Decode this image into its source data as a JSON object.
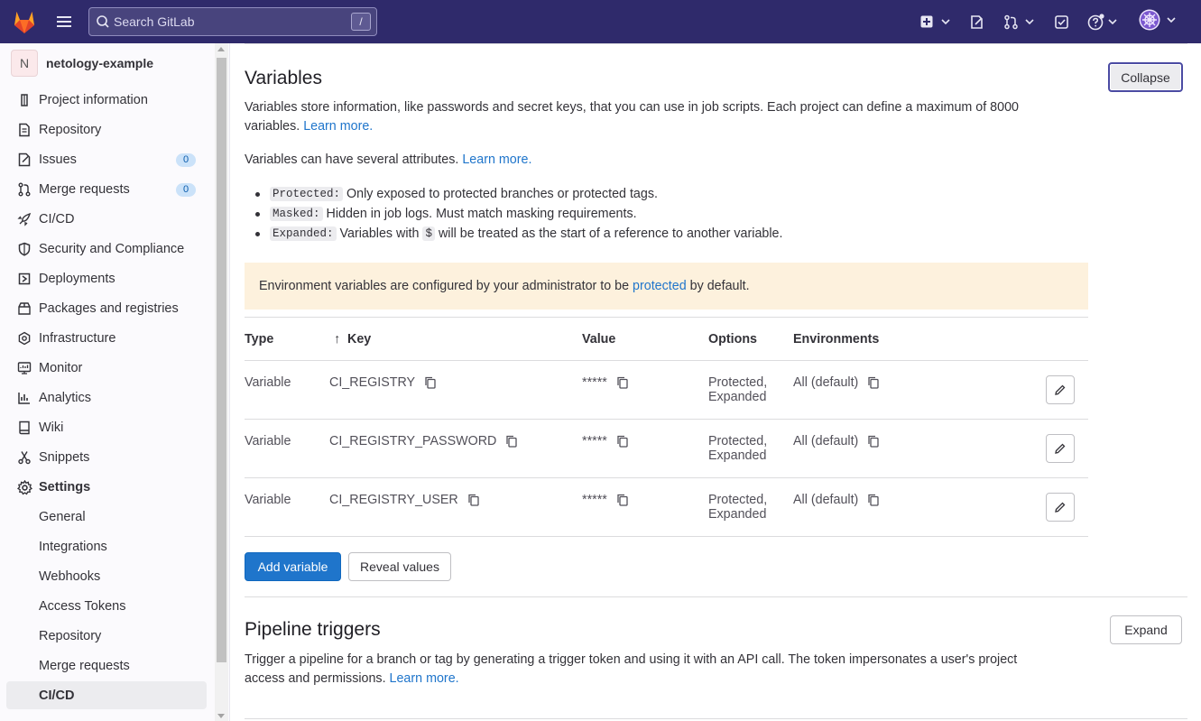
{
  "topbar": {
    "search_placeholder": "Search GitLab",
    "search_shortcut": "/"
  },
  "sidebar": {
    "project_initial": "N",
    "project_name": "netology-example",
    "items": [
      {
        "label": "Project information",
        "icon": "info-icon"
      },
      {
        "label": "Repository",
        "icon": "doc-icon"
      },
      {
        "label": "Issues",
        "icon": "issues-icon",
        "badge": "0"
      },
      {
        "label": "Merge requests",
        "icon": "merge-request-icon",
        "badge": "0"
      },
      {
        "label": "CI/CD",
        "icon": "rocket-icon"
      },
      {
        "label": "Security and Compliance",
        "icon": "shield-icon"
      },
      {
        "label": "Deployments",
        "icon": "deployments-icon"
      },
      {
        "label": "Packages and registries",
        "icon": "package-icon"
      },
      {
        "label": "Infrastructure",
        "icon": "cloud-gear-icon"
      },
      {
        "label": "Monitor",
        "icon": "monitor-icon"
      },
      {
        "label": "Analytics",
        "icon": "chart-icon"
      },
      {
        "label": "Wiki",
        "icon": "book-icon"
      },
      {
        "label": "Snippets",
        "icon": "scissors-icon"
      },
      {
        "label": "Settings",
        "icon": "gear-icon"
      }
    ],
    "settings_sub": [
      "General",
      "Integrations",
      "Webhooks",
      "Access Tokens",
      "Repository",
      "Merge requests",
      "CI/CD"
    ]
  },
  "variables": {
    "title": "Variables",
    "collapse_label": "Collapse",
    "intro": "Variables store information, like passwords and secret keys, that you can use in job scripts. Each project can define a maximum of 8000",
    "intro_line2": "variables.",
    "learn_more": "Learn more.",
    "attrs_text": "Variables can have several attributes.",
    "bullets": [
      {
        "code": "Protected:",
        "text": "Only exposed to protected branches or protected tags."
      },
      {
        "code": "Masked:",
        "text": "Hidden in job logs. Must match masking requirements."
      },
      {
        "code": "Expanded:",
        "text": "Variables with",
        "code2": "$",
        "text2": "will be treated as the start of a reference to another variable."
      }
    ],
    "alert_before": "Environment variables are configured by your administrator to be",
    "alert_link": "protected",
    "alert_after": "by default.",
    "columns": {
      "type": "Type",
      "key": "Key",
      "sort_arrow": "↑",
      "value": "Value",
      "options": "Options",
      "environments": "Environments"
    },
    "rows": [
      {
        "type": "Variable",
        "key": "CI_REGISTRY",
        "value": "*****",
        "options1": "Protected,",
        "options2": "Expanded",
        "env": "All (default)"
      },
      {
        "type": "Variable",
        "key": "CI_REGISTRY_PASSWORD",
        "value": "*****",
        "options1": "Protected,",
        "options2": "Expanded",
        "env": "All (default)"
      },
      {
        "type": "Variable",
        "key": "CI_REGISTRY_USER",
        "value": "*****",
        "options1": "Protected,",
        "options2": "Expanded",
        "env": "All (default)"
      }
    ],
    "add_label": "Add variable",
    "reveal_label": "Reveal values"
  },
  "triggers": {
    "title": "Pipeline triggers",
    "expand_label": "Expand",
    "desc1": "Trigger a pipeline for a branch or tag by generating a trigger token and using it with an API call. The token impersonates a user's project",
    "desc2": "access and permissions.",
    "learn_more": "Learn more."
  },
  "colors": {
    "topbar": "#2f2a6b",
    "primary": "#1f75cb",
    "alert_bg": "#fdf1dd"
  }
}
